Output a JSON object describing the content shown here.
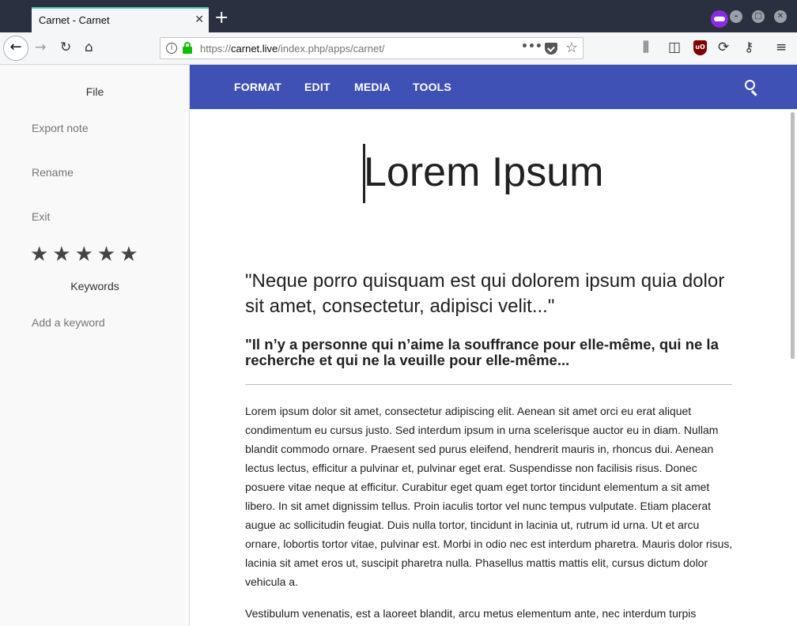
{
  "browser": {
    "tab_title": "Carnet - Carnet",
    "tab_close": "✕",
    "new_tab": "+",
    "url_prefix": "https://",
    "url_domain": "carnet.live",
    "url_path": "/index.php/apps/carnet/",
    "icons": [
      "back-icon",
      "forward-icon",
      "reload-icon",
      "home-icon",
      "site-info-icon",
      "lock-icon",
      "page-actions-icon",
      "pocket-icon",
      "bookmark-star-icon",
      "library-icon",
      "sidebar-icon",
      "ublock-icon",
      "sync-icon",
      "key-icon",
      "menu-icon",
      "private-browsing-icon"
    ],
    "ublock_label": "uO"
  },
  "sidebar": {
    "file_label": "File",
    "items": [
      "Export note",
      "Rename",
      "Exit"
    ],
    "rating_stars": "★★★★★",
    "keywords_label": "Keywords",
    "add_keyword": "Add a keyword"
  },
  "appbar": {
    "menus": [
      "FORMAT",
      "EDIT",
      "MEDIA",
      "TOOLS"
    ],
    "accent": "#3f51b5"
  },
  "document": {
    "title": "Lorem Ipsum",
    "quote": "\"Neque porro quisquam est qui dolorem ipsum quia dolor sit amet, consectetur, adipisci velit...\"",
    "subheading": "\"Il n’y a personne qui n’aime la souffrance pour elle-même, qui ne la recherche et qui ne la veuille pour elle-même...",
    "paragraphs": [
      "Lorem ipsum dolor sit amet, consectetur adipiscing elit. Aenean sit amet orci eu erat aliquet condimentum eu cursus justo. Sed interdum ipsum in urna scelerisque auctor eu in diam. Nullam blandit commodo ornare. Praesent sed purus eleifend, hendrerit mauris in, rhoncus dui. Aenean lectus lectus, efficitur a pulvinar et, pulvinar eget erat. Suspendisse non facilisis risus. Donec posuere vitae neque at efficitur. Curabitur eget quam eget tortor tincidunt elementum a sit amet libero. In sit amet dignissim tellus. Proin iaculis tortor vel nunc tempus vulputate. Etiam placerat augue ac sollicitudin feugiat. Duis nulla tortor, tincidunt in lacinia ut, rutrum id urna. Ut et arcu ornare, lobortis tortor vitae, pulvinar est. Morbi in odio nec est interdum pharetra. Mauris dolor risus, lacinia sit amet eros ut, suscipit pharetra nulla. Phasellus mattis mattis elit, cursus dictum dolor vehicula a.",
      "Vestibulum venenatis, est a laoreet blandit, arcu metus elementum ante, nec interdum turpis"
    ]
  }
}
